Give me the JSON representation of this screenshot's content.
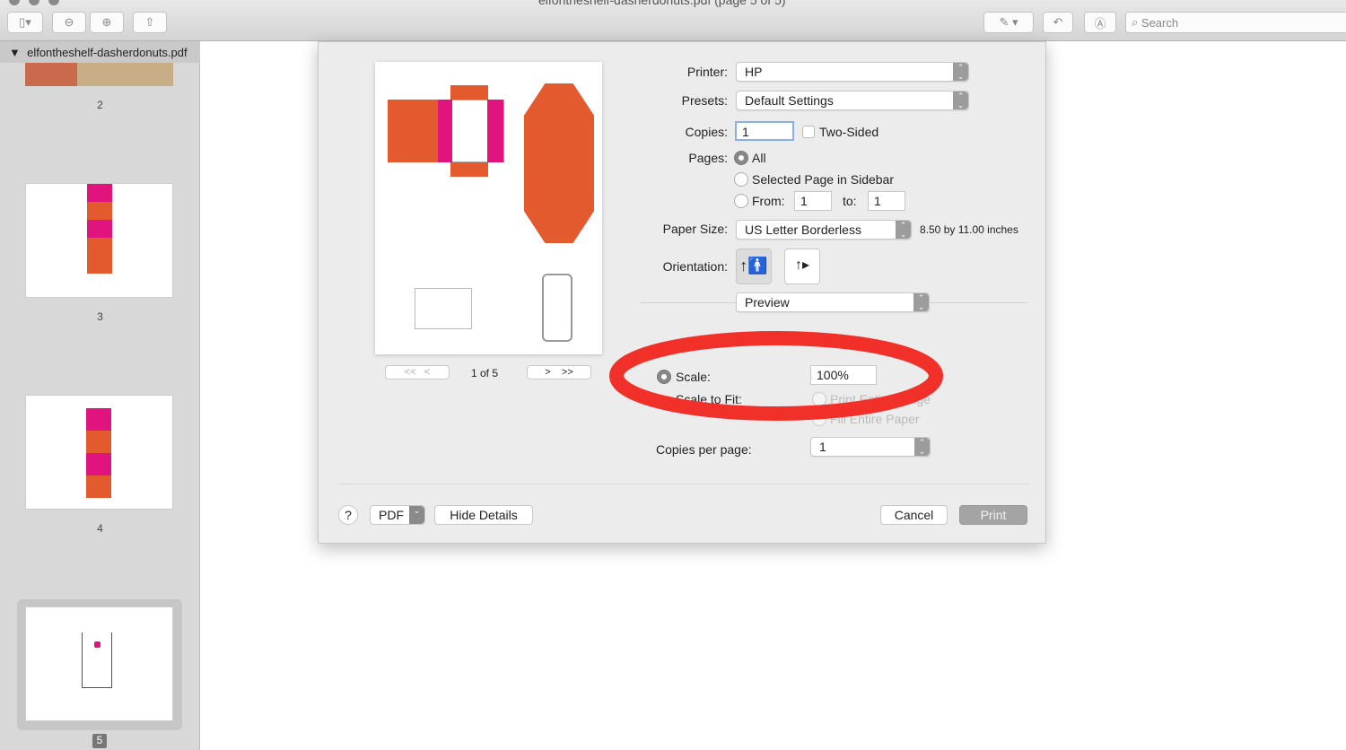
{
  "window": {
    "title": "elfontheshelf-dasherdonuts.pdf (page 5 of 5)",
    "search_placeholder": "Search"
  },
  "sidebar": {
    "file": "elfontheshelf-dasherdonuts.pdf",
    "pages": [
      "2",
      "3",
      "4",
      "5"
    ],
    "selected": "5"
  },
  "preview": {
    "page_indicator": "1 of 5",
    "first": "<<",
    "prev": "<",
    "next": ">",
    "last": ">>"
  },
  "print": {
    "printer_label": "Printer:",
    "printer": "HP",
    "presets_label": "Presets:",
    "presets": "Default Settings",
    "copies_label": "Copies:",
    "copies": "1",
    "two_sided": "Two-Sided",
    "pages_label": "Pages:",
    "all": "All",
    "selected_page": "Selected Page in Sidebar",
    "from_label": "From:",
    "from": "1",
    "to_label": "to:",
    "to": "1",
    "paper_size_label": "Paper Size:",
    "paper_size": "US Letter Borderless",
    "paper_dims": "8.50 by 11.00 inches",
    "orientation_label": "Orientation:",
    "section": "Preview",
    "scale_label": "Scale:",
    "scale": "100%",
    "scale_to_fit": "Scale to Fit:",
    "print_entire": "Print Entire Image",
    "fill_paper": "Fill Entire Paper",
    "copies_per_page_label": "Copies per page:",
    "copies_per_page": "1",
    "help": "?",
    "pdf": "PDF",
    "hide_details": "Hide Details",
    "cancel": "Cancel",
    "print": "Print"
  },
  "annotation_color": "#f2302a"
}
